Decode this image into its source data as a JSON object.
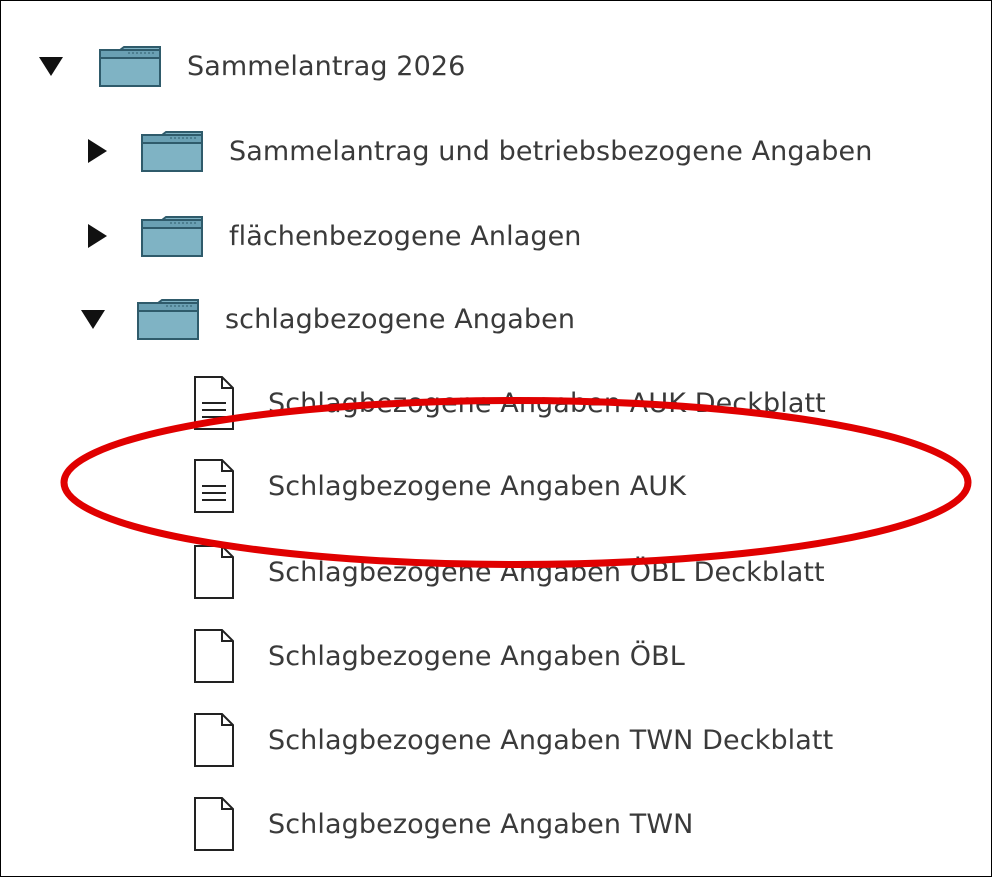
{
  "tree": {
    "root": {
      "label": "Sammelantrag 2026",
      "expanded": true,
      "icon": "folder-icon"
    },
    "folders": [
      {
        "label": "Sammelantrag und betriebsbezogene Angaben",
        "expanded": false,
        "icon": "folder-icon"
      },
      {
        "label": "flächenbezogene Anlagen",
        "expanded": false,
        "icon": "folder-icon"
      },
      {
        "label": "schlagbezogene Angaben",
        "expanded": true,
        "icon": "folder-icon"
      }
    ],
    "documents": [
      {
        "label": "Schlagbezogene Angaben AUK Deckblatt",
        "icon": "document-lines-icon"
      },
      {
        "label": "Schlagbezogene Angaben AUK",
        "icon": "document-lines-icon"
      },
      {
        "label": "Schlagbezogene Angaben ÖBL Deckblatt",
        "icon": "document-blank-icon"
      },
      {
        "label": "Schlagbezogene Angaben ÖBL",
        "icon": "document-blank-icon"
      },
      {
        "label": "Schlagbezogene Angaben TWN Deckblatt",
        "icon": "document-blank-icon"
      },
      {
        "label": "Schlagbezogene Angaben TWN",
        "icon": "document-blank-icon"
      }
    ]
  },
  "annotation": {
    "shape": "ellipse",
    "color": "#e00000"
  },
  "colors": {
    "folder_fill": "#7fb3c4",
    "folder_stroke": "#2f5b6b",
    "text": "#3a3a3a"
  }
}
